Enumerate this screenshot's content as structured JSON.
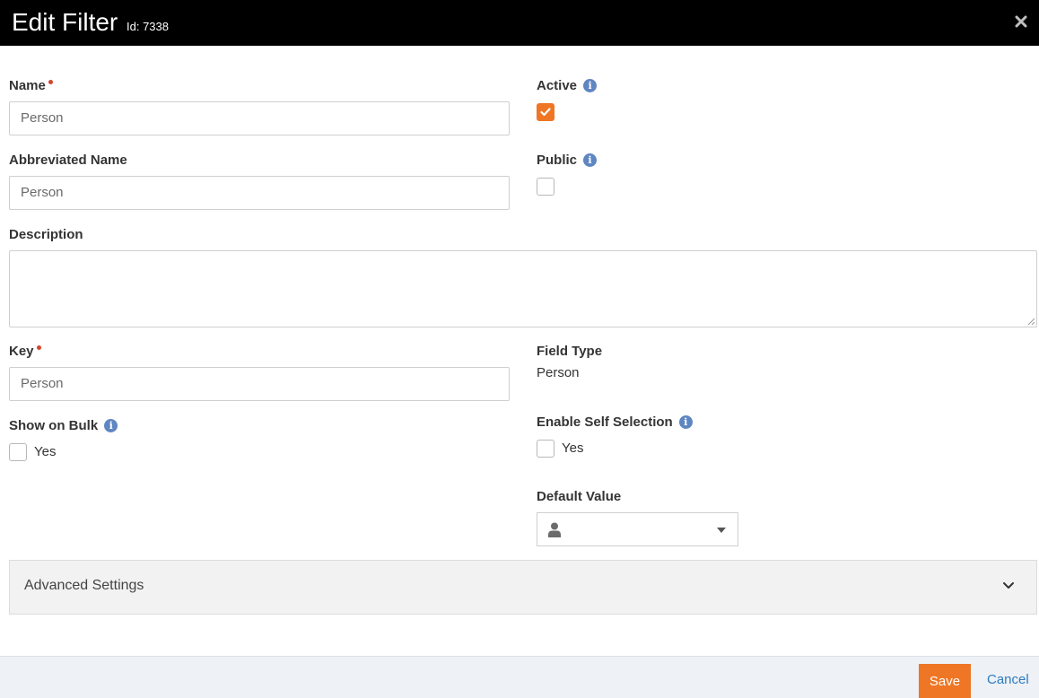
{
  "header": {
    "title": "Edit Filter",
    "id_label": "Id: 7338",
    "close_icon": "close-icon"
  },
  "form": {
    "name": {
      "label": "Name",
      "required": true,
      "value": "Person"
    },
    "abbreviated_name": {
      "label": "Abbreviated Name",
      "value": "Person"
    },
    "description": {
      "label": "Description",
      "value": ""
    },
    "key": {
      "label": "Key",
      "required": true,
      "value": "Person"
    },
    "active": {
      "label": "Active",
      "checked": true,
      "info_icon": "info-icon"
    },
    "public": {
      "label": "Public",
      "checked": false,
      "info_icon": "info-icon"
    },
    "field_type": {
      "label": "Field Type",
      "value": "Person"
    },
    "show_on_bulk": {
      "label": "Show on Bulk",
      "option": "Yes",
      "checked": false
    },
    "enable_self_selection": {
      "label": "Enable Self Selection",
      "option": "Yes",
      "checked": false
    },
    "default_value": {
      "label": "Default Value",
      "icon": "person-icon",
      "value": ""
    }
  },
  "advanced": {
    "label": "Advanced Settings",
    "icon": "chevron-down-icon"
  },
  "footer": {
    "save_label": "Save",
    "cancel_label": "Cancel"
  },
  "colors": {
    "accent": "#ee7625",
    "header_bg": "#000000",
    "info": "#5f86c1",
    "link": "#2b7cc2",
    "required": "#d4442e"
  }
}
